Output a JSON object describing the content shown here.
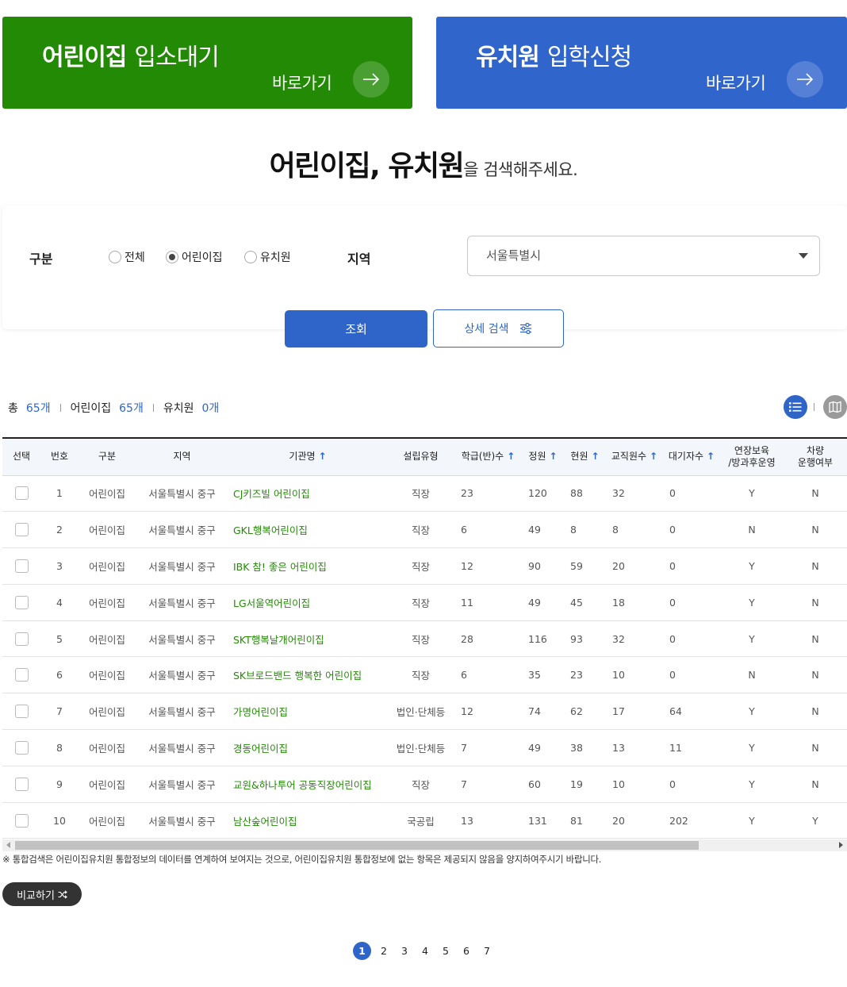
{
  "banners": {
    "daycare": {
      "title_strong": "어린이집",
      "title_light": "입소대기",
      "go_label": "바로가기"
    },
    "kindergarten": {
      "title_strong": "유치원",
      "title_light": "입학신청",
      "go_label": "바로가기"
    }
  },
  "heading": {
    "strong": "어린이집, 유치원",
    "light": "을 검색해주세요."
  },
  "search": {
    "type_label": "구분",
    "options": [
      "전체",
      "어린이집",
      "유치원"
    ],
    "selected_option": "어린이집",
    "region_label": "지역",
    "region_value": "서울특별시",
    "search_button": "조회",
    "detail_button": "상세 검색"
  },
  "summary": {
    "total_label": "총",
    "total_count": "65개",
    "daycare_label": "어린이집",
    "daycare_count": "65개",
    "kinder_label": "유치원",
    "kinder_count": "0개"
  },
  "table": {
    "headers": {
      "select": "선택",
      "no": "번호",
      "type": "구분",
      "region": "지역",
      "name": "기관명",
      "founding": "설립유형",
      "classes": "학급(반)수",
      "capacity": "정원",
      "current": "현원",
      "staff": "교직원수",
      "waiting": "대기자수",
      "extended_1": "연장보육",
      "extended_2": "/방과후운영",
      "vehicle_1": "차량",
      "vehicle_2": "운행여부"
    },
    "rows": [
      {
        "no": "1",
        "type": "어린이집",
        "region": "서울특별시 중구",
        "name": "CJ키즈빌 어린이집",
        "founding": "직장",
        "classes": "23",
        "capacity": "120",
        "current": "88",
        "staff": "32",
        "waiting": "0",
        "extended": "Y",
        "vehicle": "N"
      },
      {
        "no": "2",
        "type": "어린이집",
        "region": "서울특별시 중구",
        "name": "GKL행복어린이집",
        "founding": "직장",
        "classes": "6",
        "capacity": "49",
        "current": "8",
        "staff": "8",
        "waiting": "0",
        "extended": "N",
        "vehicle": "N"
      },
      {
        "no": "3",
        "type": "어린이집",
        "region": "서울특별시 중구",
        "name": "IBK 참! 좋은 어린이집",
        "founding": "직장",
        "classes": "12",
        "capacity": "90",
        "current": "59",
        "staff": "20",
        "waiting": "0",
        "extended": "Y",
        "vehicle": "N"
      },
      {
        "no": "4",
        "type": "어린이집",
        "region": "서울특별시 중구",
        "name": "LG서울역어린이집",
        "founding": "직장",
        "classes": "11",
        "capacity": "49",
        "current": "45",
        "staff": "18",
        "waiting": "0",
        "extended": "Y",
        "vehicle": "N"
      },
      {
        "no": "5",
        "type": "어린이집",
        "region": "서울특별시 중구",
        "name": "SKT행복날개어린이집",
        "founding": "직장",
        "classes": "28",
        "capacity": "116",
        "current": "93",
        "staff": "32",
        "waiting": "0",
        "extended": "Y",
        "vehicle": "N"
      },
      {
        "no": "6",
        "type": "어린이집",
        "region": "서울특별시 중구",
        "name": "SK브로드밴드 행복한 어린이집",
        "founding": "직장",
        "classes": "6",
        "capacity": "35",
        "current": "23",
        "staff": "10",
        "waiting": "0",
        "extended": "N",
        "vehicle": "N"
      },
      {
        "no": "7",
        "type": "어린이집",
        "region": "서울특별시 중구",
        "name": "가명어린이집",
        "founding": "법인·단체등",
        "classes": "12",
        "capacity": "74",
        "current": "62",
        "staff": "17",
        "waiting": "64",
        "extended": "Y",
        "vehicle": "N"
      },
      {
        "no": "8",
        "type": "어린이집",
        "region": "서울특별시 중구",
        "name": "경동어린이집",
        "founding": "법인·단체등",
        "classes": "7",
        "capacity": "49",
        "current": "38",
        "staff": "13",
        "waiting": "11",
        "extended": "Y",
        "vehicle": "N"
      },
      {
        "no": "9",
        "type": "어린이집",
        "region": "서울특별시 중구",
        "name": "교원&하나투어 공동직장어린이집",
        "founding": "직장",
        "classes": "7",
        "capacity": "60",
        "current": "19",
        "staff": "10",
        "waiting": "0",
        "extended": "Y",
        "vehicle": "N"
      },
      {
        "no": "10",
        "type": "어린이집",
        "region": "서울특별시 중구",
        "name": "남산숲어린이집",
        "founding": "국공립",
        "classes": "13",
        "capacity": "131",
        "current": "81",
        "staff": "20",
        "waiting": "202",
        "extended": "Y",
        "vehicle": "Y"
      }
    ]
  },
  "note": "※ 통합검색은 어린이집유치원 통합정보의 데이터를 연계하여 보여지는 것으로, 어린이집유치원 통합정보에 없는 항목은 제공되지 않음을 양지하여주시기 바랍니다.",
  "compare_button": "비교하기",
  "pagination": {
    "pages": [
      "1",
      "2",
      "3",
      "4",
      "5",
      "6",
      "7"
    ],
    "current": "1"
  },
  "colors": {
    "green": "#238a06",
    "blue": "#3065cc",
    "accent": "#2f65c9"
  },
  "icons": {
    "banner_arrow": "arrow-right-icon",
    "detail": "sliders-icon",
    "list_view": "list-icon",
    "map_view": "map-icon",
    "compare": "shuffle-icon",
    "select": "caret-down-icon"
  }
}
